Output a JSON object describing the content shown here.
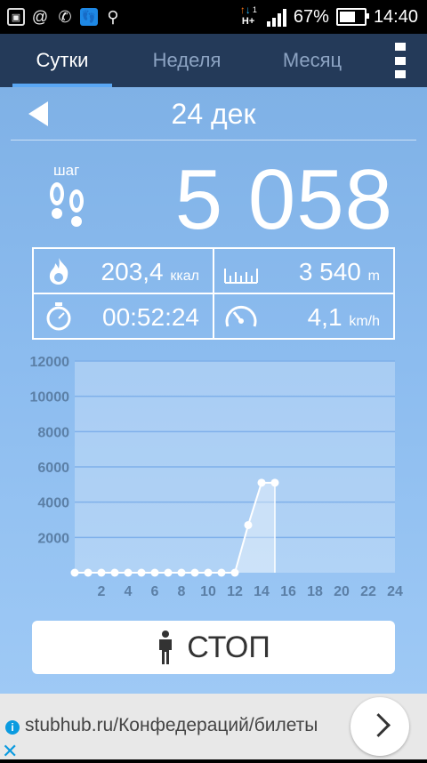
{
  "status_bar": {
    "left_icons": [
      "gallery-icon",
      "at-icon",
      "whatsapp-icon",
      "fitness-app-icon",
      "search-icon"
    ],
    "network": {
      "type": "H+",
      "sim": "1"
    },
    "battery": "67%",
    "battery_level": 0.67,
    "time": "14:40"
  },
  "tabs": [
    {
      "label": "Сутки",
      "active": true
    },
    {
      "label": "Неделя",
      "active": false
    },
    {
      "label": "Месяц",
      "active": false
    }
  ],
  "date": "24 дек",
  "steps": {
    "label": "шаг",
    "value": "5 058"
  },
  "stats": {
    "calories": {
      "value": "203,4",
      "unit": "ккал"
    },
    "distance": {
      "value": "3 540",
      "unit": "m"
    },
    "duration": {
      "value": "00:52:24"
    },
    "speed": {
      "value": "4,1",
      "unit": "km/h"
    }
  },
  "chart_data": {
    "type": "area",
    "x": [
      0,
      1,
      2,
      3,
      4,
      5,
      6,
      7,
      8,
      9,
      10,
      11,
      12,
      13,
      14,
      15
    ],
    "values": [
      0,
      0,
      0,
      0,
      0,
      0,
      0,
      0,
      0,
      0,
      0,
      0,
      0,
      2700,
      5100,
      5100
    ],
    "xlim": [
      0,
      24
    ],
    "ylim": [
      0,
      12000
    ],
    "x_ticks": [
      "2",
      "4",
      "6",
      "8",
      "10",
      "12",
      "14",
      "16",
      "18",
      "20",
      "22",
      "24"
    ],
    "y_ticks": [
      "2000",
      "4000",
      "6000",
      "8000",
      "10000",
      "12000"
    ],
    "grid": true,
    "colors": {
      "line": "#ffffff",
      "fill": "rgba(255,255,255,0.35)",
      "grid": "#7fb0ea",
      "axis_text": "#5b7fa6",
      "plot_bg": "rgba(255,255,255,0.25)"
    }
  },
  "stop_button": {
    "label": "СТОП"
  },
  "ad": {
    "text": "stubhub.ru/Конфедераций/билеты"
  }
}
